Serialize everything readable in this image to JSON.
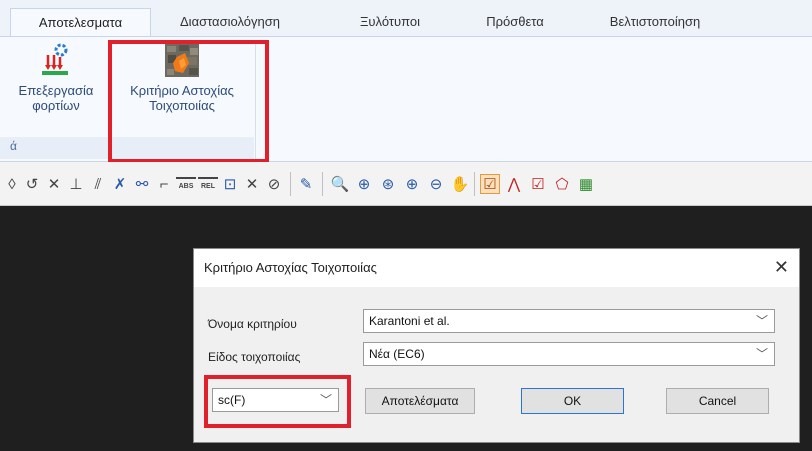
{
  "ribbon_tabs": [
    {
      "label": "Αποτελεσματα",
      "active": true
    },
    {
      "label": "Διαστασιολόγηση",
      "active": false
    },
    {
      "label": "Ξυλότυποι",
      "active": false
    },
    {
      "label": "Πρόσθετα",
      "active": false
    },
    {
      "label": "Βελτιστοποίηση",
      "active": false
    }
  ],
  "ribbon": {
    "load_processing": {
      "line1": "Επεξεργασία",
      "line2": "φορτίων",
      "icon": "load-arrows-icon"
    },
    "wall_failure": {
      "line1": "Κριτήριο Αστοχίας",
      "line2": "Τοιχοποιίας",
      "icon": "masonry-failure-icon"
    },
    "group_label": "ά"
  },
  "toolbar": {
    "tools": [
      {
        "name": "rotate-tool-icon",
        "glyph": "◊"
      },
      {
        "name": "arc-tool-icon",
        "glyph": "↺"
      },
      {
        "name": "trim-tool-icon",
        "glyph": "✕"
      },
      {
        "name": "dimension-tool-icon",
        "glyph": "⊥"
      },
      {
        "name": "parallel-tool-icon",
        "glyph": "⫽"
      },
      {
        "name": "cross-tool-icon",
        "glyph": "✗"
      },
      {
        "name": "snap-tool-icon",
        "glyph": "⚯"
      },
      {
        "name": "corner-tool-icon",
        "glyph": "⌐"
      },
      {
        "name": "abs-tool-icon",
        "glyph": "ABS"
      },
      {
        "name": "rel-tool-icon",
        "glyph": "REL"
      },
      {
        "name": "frame-tool-icon",
        "glyph": "⊡"
      },
      {
        "name": "delete-tool-icon",
        "glyph": "✕"
      },
      {
        "name": "lock-tool-icon",
        "glyph": "⊘"
      },
      {
        "name": "pencil-tool-icon",
        "glyph": "✎"
      },
      {
        "name": "zoom-window-icon",
        "glyph": "🔍"
      },
      {
        "name": "zoom-all-icon",
        "glyph": "⊕"
      },
      {
        "name": "zoom-previous-icon",
        "glyph": "⊛"
      },
      {
        "name": "zoom-in-icon",
        "glyph": "⊕"
      },
      {
        "name": "zoom-out-icon",
        "glyph": "⊖"
      },
      {
        "name": "pan-icon",
        "glyph": "✋"
      },
      {
        "name": "check-toggle-icon",
        "glyph": "☑"
      },
      {
        "name": "line-chart-icon",
        "glyph": "⋀"
      },
      {
        "name": "checkbox-icon",
        "glyph": "☑"
      },
      {
        "name": "polygon-icon",
        "glyph": "⬠"
      },
      {
        "name": "histogram-icon",
        "glyph": "▦"
      }
    ]
  },
  "dialog": {
    "title": "Κριτήριο Αστοχίας Τοιχοποιίας",
    "close_glyph": "✕",
    "criterion_label": "Όνομα κριτηρίου",
    "criterion_value": "Karantoni et al.",
    "wall_type_label": "Είδος τοιχοποιίας",
    "wall_type_value": "Νέα (EC6)",
    "function_value": "sc(F)",
    "results_button": "Αποτελέσματα",
    "ok_button": "OK",
    "cancel_button": "Cancel",
    "arrow_glyph": "﹀"
  },
  "colors": {
    "highlight": "#e0202a",
    "dialog_bg": "#f0f0f0",
    "canvas_bg": "#1f1f1f"
  }
}
